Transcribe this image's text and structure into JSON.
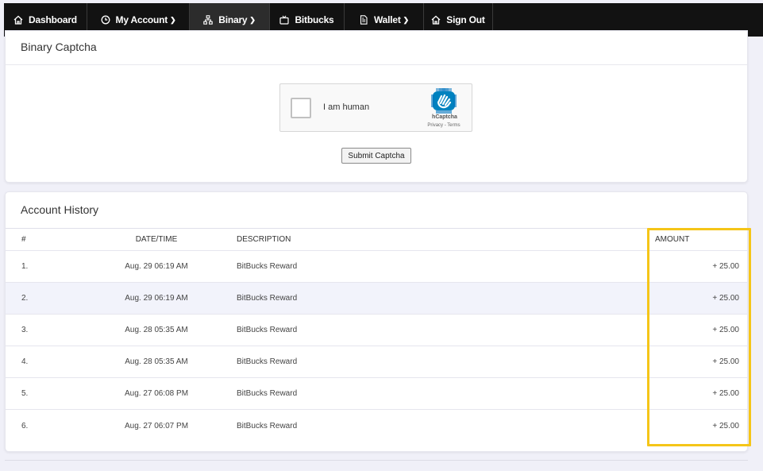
{
  "nav": {
    "items": [
      {
        "label": "Dashboard",
        "icon": "home-icon",
        "dropdown": false,
        "active": false
      },
      {
        "label": "My Account",
        "icon": "clock-icon",
        "dropdown": true,
        "active": false
      },
      {
        "label": "Binary",
        "icon": "sitemap-icon",
        "dropdown": true,
        "active": true
      },
      {
        "label": "Bitbucks",
        "icon": "tv-icon",
        "dropdown": false,
        "active": false
      },
      {
        "label": "Wallet",
        "icon": "document-icon",
        "dropdown": true,
        "active": false
      },
      {
        "label": "Sign Out",
        "icon": "home-icon",
        "dropdown": false,
        "active": false
      }
    ]
  },
  "captcha_card": {
    "title": "Binary Captcha",
    "widget_text": "I am human",
    "brand": "hCaptcha",
    "links": "Privacy - Terms",
    "submit_label": "Submit Captcha"
  },
  "history": {
    "title": "Account History",
    "columns": [
      "#",
      "DATE/TIME",
      "DESCRIPTION",
      "AMOUNT"
    ],
    "rows": [
      {
        "num": "1.",
        "date": "Aug. 29 06:19 AM",
        "desc": "BitBucks Reward",
        "amount": "+ 25.00"
      },
      {
        "num": "2.",
        "date": "Aug. 29 06:19 AM",
        "desc": "BitBucks Reward",
        "amount": "+ 25.00"
      },
      {
        "num": "3.",
        "date": "Aug. 28 05:35 AM",
        "desc": "BitBucks Reward",
        "amount": "+ 25.00"
      },
      {
        "num": "4.",
        "date": "Aug. 28 05:35 AM",
        "desc": "BitBucks Reward",
        "amount": "+ 25.00"
      },
      {
        "num": "5.",
        "date": "Aug. 27 06:08 PM",
        "desc": "BitBucks Reward",
        "amount": "+ 25.00"
      },
      {
        "num": "6.",
        "date": "Aug. 27 06:07 PM",
        "desc": "BitBucks Reward",
        "amount": "+ 25.00"
      }
    ]
  },
  "colors": {
    "nav_bg": "#121212",
    "highlight": "#f5c518",
    "alt_row": "#f2f3fb"
  }
}
